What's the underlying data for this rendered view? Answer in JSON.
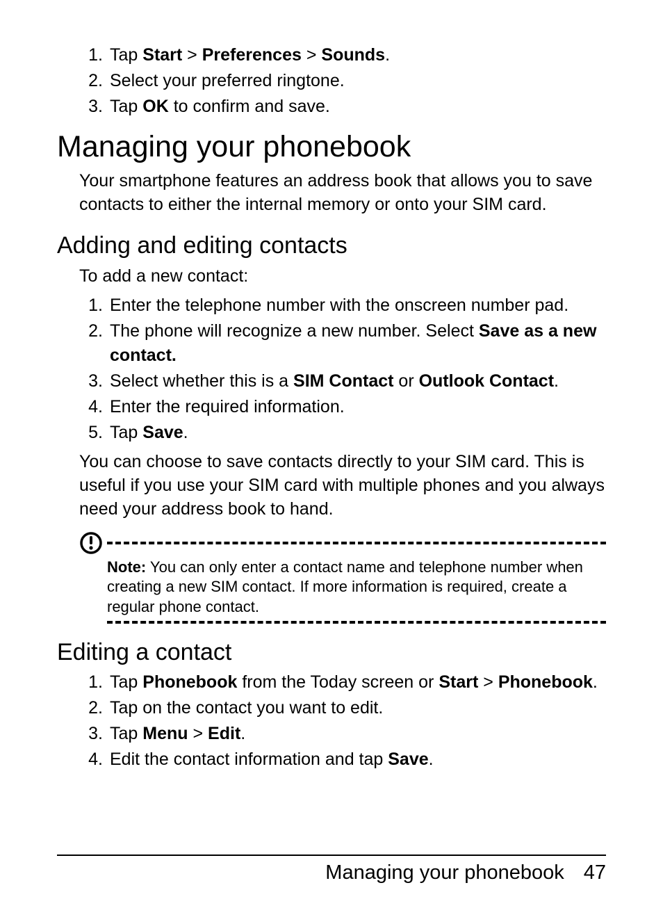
{
  "top_steps": [
    {
      "n": "1.",
      "t": "Tap ",
      "b1": "Start",
      "m1": " > ",
      "b2": "Preferences",
      "m2": " > ",
      "b3": "Sounds",
      "end": "."
    },
    {
      "n": "2.",
      "t": "Select your preferred ringtone."
    },
    {
      "n": "3.",
      "t": "Tap ",
      "b1": "OK",
      "end": " to confirm and save."
    }
  ],
  "h1": "Managing your phonebook",
  "intro": "Your smartphone features an address book that allows you to save contacts to either the internal memory or onto your SIM card.",
  "h2a": "Adding and editing contacts",
  "add_intro": "To add a new contact:",
  "add_steps": [
    {
      "n": "1.",
      "t": "Enter the telephone number with the onscreen number pad."
    },
    {
      "n": "2.",
      "t": "The phone will recognize a new number. Select  ",
      "b1": "Save as a new contact.",
      "end": ""
    },
    {
      "n": "3.",
      "t": "Select whether this is a ",
      "b1": "SIM Contact",
      "m1": " or ",
      "b2": "Outlook Contact",
      "end": "."
    },
    {
      "n": "4.",
      "t": "Enter the required information."
    },
    {
      "n": "5.",
      "t": "Tap ",
      "b1": "Save",
      "end": "."
    }
  ],
  "sim_para": "You can choose to save contacts directly to your SIM card. This is useful if you use your SIM card with multiple phones and you always need your address book to hand.",
  "note_label": "Note:",
  "note_text": " You can only enter a contact name and telephone number when creating a new SIM contact. If more information is required, create a regular phone contact.",
  "h2b": "Editing a contact",
  "edit_steps": [
    {
      "n": "1.",
      "t": "Tap ",
      "b1": "Phonebook",
      "m1": " from the Today screen or ",
      "b2": "Start",
      "m2": " > ",
      "b3": "Phone­book",
      "end": "."
    },
    {
      "n": "2.",
      "t": "Tap on the contact you want to edit."
    },
    {
      "n": "3.",
      "t": "Tap ",
      "b1": "Menu",
      "m1": " > ",
      "b2": "Edit",
      "end": "."
    },
    {
      "n": "4.",
      "t": "Edit the contact information and tap ",
      "b1": "Save",
      "end": "."
    }
  ],
  "footer_title": "Managing your phonebook",
  "footer_page": "47"
}
